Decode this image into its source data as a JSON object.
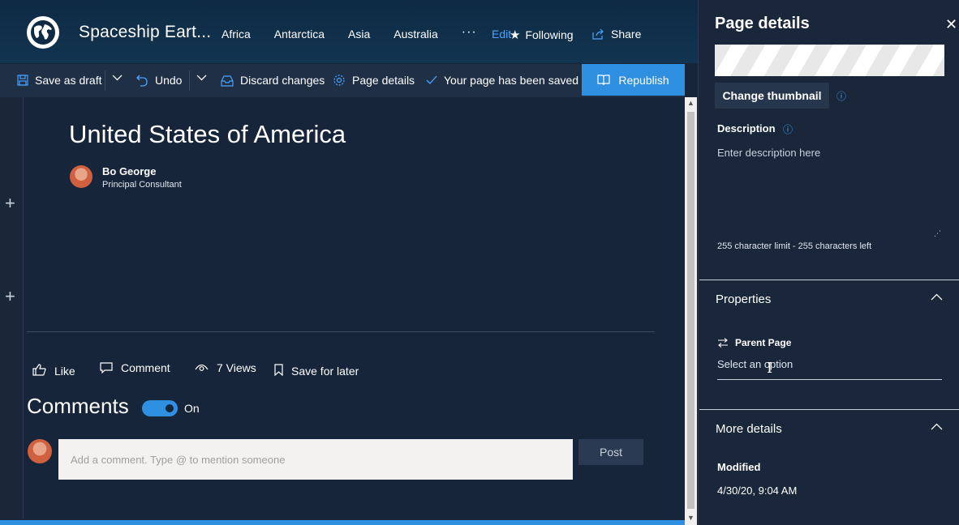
{
  "header": {
    "site_title": "Spaceship Eart...",
    "nav": [
      "Africa",
      "Antarctica",
      "Asia",
      "Australia"
    ],
    "more": "···",
    "edit": "Edit",
    "following": "Following",
    "share": "Share"
  },
  "cmdbar": {
    "save_draft": "Save as draft",
    "undo": "Undo",
    "discard": "Discard changes",
    "page_details": "Page details",
    "saved_status": "Your page has been saved",
    "republish": "Republish"
  },
  "page": {
    "title": "United States of America",
    "author_name": "Bo George",
    "author_role": "Principal Consultant"
  },
  "social": {
    "like": "Like",
    "comment": "Comment",
    "views": "7 Views",
    "save_later": "Save for later"
  },
  "comments": {
    "title": "Comments",
    "toggle_state": "On",
    "placeholder": "Add a comment. Type @ to mention someone",
    "post": "Post"
  },
  "panel": {
    "title": "Page details",
    "change_thumbnail": "Change thumbnail",
    "description_label": "Description",
    "description_placeholder": "Enter description here",
    "char_limit": "255 character limit - 255 characters left",
    "properties": "Properties",
    "parent_page_label": "Parent Page",
    "parent_page_placeholder": "Select an option",
    "more_details": "More details",
    "modified_label": "Modified",
    "modified_value": "4/30/20, 9:04 AM"
  },
  "colors": {
    "accent": "#2f8fe0",
    "background": "#17253a",
    "link": "#4aa3ff"
  }
}
